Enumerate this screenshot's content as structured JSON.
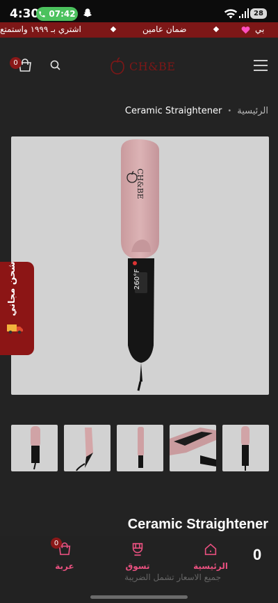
{
  "status_bar": {
    "time": "4:30",
    "call_duration": "07:42",
    "battery": "28"
  },
  "promo": {
    "items": [
      "بي",
      "ضمان عامين",
      "اشتري بـ ١٩٩٩ واستمتع"
    ],
    "heart_color": "#ff4fc0"
  },
  "header": {
    "cart_count": "0",
    "logo_text": "CH&BE",
    "brand_color": "#7d1717"
  },
  "breadcrumb": {
    "home": "الرئيسية",
    "current": "Ceramic Straightener"
  },
  "product": {
    "title": "Ceramic Straightener",
    "image_brand": "CH&BE",
    "display_temp": "260°F",
    "price_partial": "0",
    "subtitle_partial": "جميع الاسعار تشمل الضريبة"
  },
  "shipping_tab": {
    "label": "شحن مجاني"
  },
  "thumbnails": [
    "front",
    "side",
    "profile",
    "open",
    "detail"
  ],
  "bottom_nav": {
    "home": "الرئيسية",
    "shop": "تسوق",
    "cart": "عربة",
    "cart_count": "0",
    "accent_color": "#e8507f"
  }
}
